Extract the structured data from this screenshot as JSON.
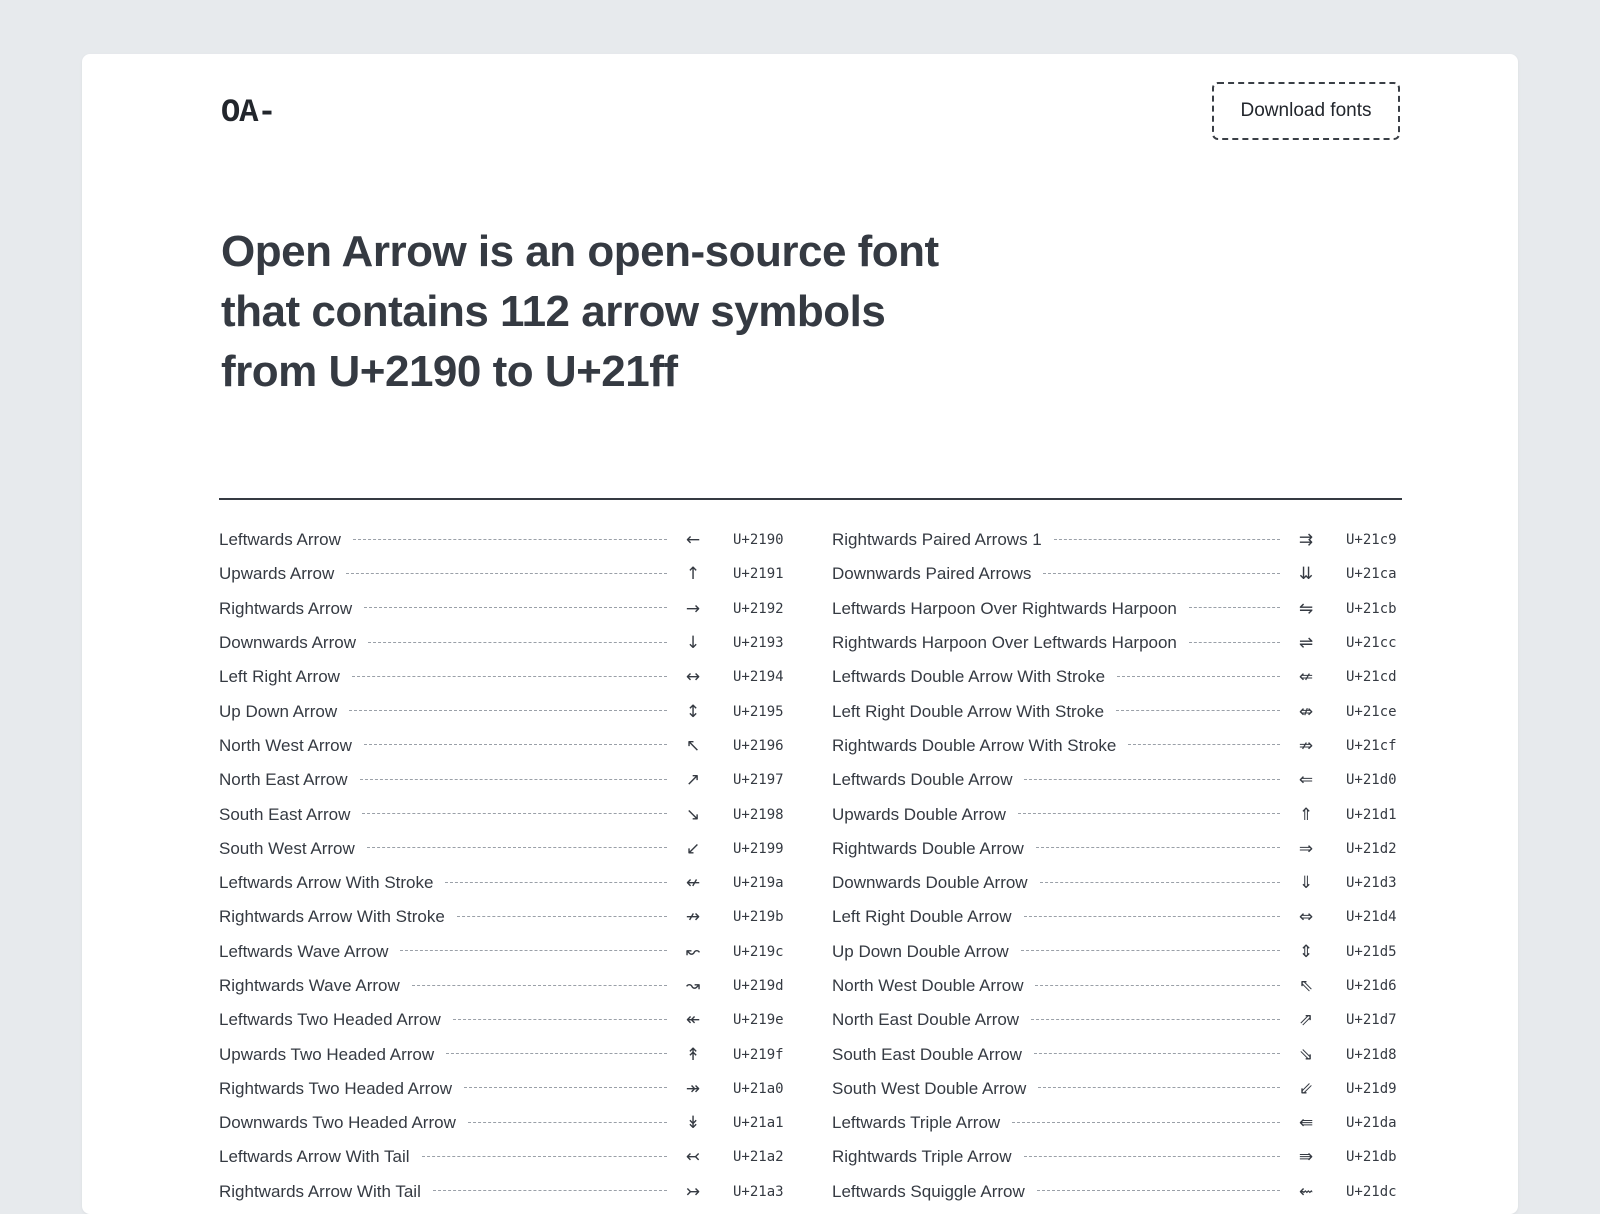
{
  "header": {
    "logo": "OA-",
    "download_label": "Download fonts"
  },
  "hero": {
    "title": "Open Arrow is an open-source font that contains 112 arrow symbols from U+2190 to U+21ff"
  },
  "arrows_left": [
    {
      "name": "Leftwards Arrow",
      "glyph": "←",
      "code": "U+2190"
    },
    {
      "name": "Upwards Arrow",
      "glyph": "↑",
      "code": "U+2191"
    },
    {
      "name": "Rightwards Arrow",
      "glyph": "→",
      "code": "U+2192"
    },
    {
      "name": "Downwards Arrow",
      "glyph": "↓",
      "code": "U+2193"
    },
    {
      "name": "Left Right Arrow",
      "glyph": "↔",
      "code": "U+2194"
    },
    {
      "name": "Up Down Arrow",
      "glyph": "↕",
      "code": "U+2195"
    },
    {
      "name": "North West Arrow",
      "glyph": "↖",
      "code": "U+2196"
    },
    {
      "name": "North East Arrow",
      "glyph": "↗",
      "code": "U+2197"
    },
    {
      "name": "South East Arrow",
      "glyph": "↘",
      "code": "U+2198"
    },
    {
      "name": "South West Arrow",
      "glyph": "↙",
      "code": "U+2199"
    },
    {
      "name": "Leftwards Arrow With Stroke",
      "glyph": "↚",
      "code": "U+219a"
    },
    {
      "name": "Rightwards Arrow With Stroke",
      "glyph": "↛",
      "code": "U+219b"
    },
    {
      "name": "Leftwards Wave Arrow",
      "glyph": "↜",
      "code": "U+219c"
    },
    {
      "name": "Rightwards Wave Arrow",
      "glyph": "↝",
      "code": "U+219d"
    },
    {
      "name": "Leftwards Two Headed Arrow",
      "glyph": "↞",
      "code": "U+219e"
    },
    {
      "name": "Upwards Two Headed Arrow",
      "glyph": "↟",
      "code": "U+219f"
    },
    {
      "name": "Rightwards Two Headed Arrow",
      "glyph": "↠",
      "code": "U+21a0"
    },
    {
      "name": "Downwards Two Headed Arrow",
      "glyph": "↡",
      "code": "U+21a1"
    },
    {
      "name": "Leftwards Arrow With Tail",
      "glyph": "↢",
      "code": "U+21a2"
    },
    {
      "name": "Rightwards Arrow With Tail",
      "glyph": "↣",
      "code": "U+21a3"
    }
  ],
  "arrows_right": [
    {
      "name": "Rightwards Paired Arrows 1",
      "glyph": "⇉",
      "code": "U+21c9"
    },
    {
      "name": "Downwards Paired Arrows",
      "glyph": "⇊",
      "code": "U+21ca"
    },
    {
      "name": "Leftwards Harpoon Over Rightwards Harpoon",
      "glyph": "⇋",
      "code": "U+21cb"
    },
    {
      "name": "Rightwards Harpoon Over Leftwards Harpoon",
      "glyph": "⇌",
      "code": "U+21cc"
    },
    {
      "name": "Leftwards Double Arrow With Stroke",
      "glyph": "⇍",
      "code": "U+21cd"
    },
    {
      "name": "Left Right Double Arrow With Stroke",
      "glyph": "⇎",
      "code": "U+21ce"
    },
    {
      "name": "Rightwards Double Arrow With Stroke",
      "glyph": "⇏",
      "code": "U+21cf"
    },
    {
      "name": "Leftwards Double Arrow",
      "glyph": "⇐",
      "code": "U+21d0"
    },
    {
      "name": "Upwards Double Arrow",
      "glyph": "⇑",
      "code": "U+21d1"
    },
    {
      "name": "Rightwards Double Arrow",
      "glyph": "⇒",
      "code": "U+21d2"
    },
    {
      "name": "Downwards Double Arrow",
      "glyph": "⇓",
      "code": "U+21d3"
    },
    {
      "name": "Left Right Double Arrow",
      "glyph": "⇔",
      "code": "U+21d4"
    },
    {
      "name": "Up Down Double Arrow",
      "glyph": "⇕",
      "code": "U+21d5"
    },
    {
      "name": "North West Double Arrow",
      "glyph": "⇖",
      "code": "U+21d6"
    },
    {
      "name": "North East Double Arrow",
      "glyph": "⇗",
      "code": "U+21d7"
    },
    {
      "name": "South East Double Arrow",
      "glyph": "⇘",
      "code": "U+21d8"
    },
    {
      "name": "South West Double Arrow",
      "glyph": "⇙",
      "code": "U+21d9"
    },
    {
      "name": "Leftwards Triple Arrow",
      "glyph": "⇚",
      "code": "U+21da"
    },
    {
      "name": "Rightwards Triple Arrow",
      "glyph": "⇛",
      "code": "U+21db"
    },
    {
      "name": "Leftwards Squiggle Arrow",
      "glyph": "⇜",
      "code": "U+21dc"
    }
  ]
}
